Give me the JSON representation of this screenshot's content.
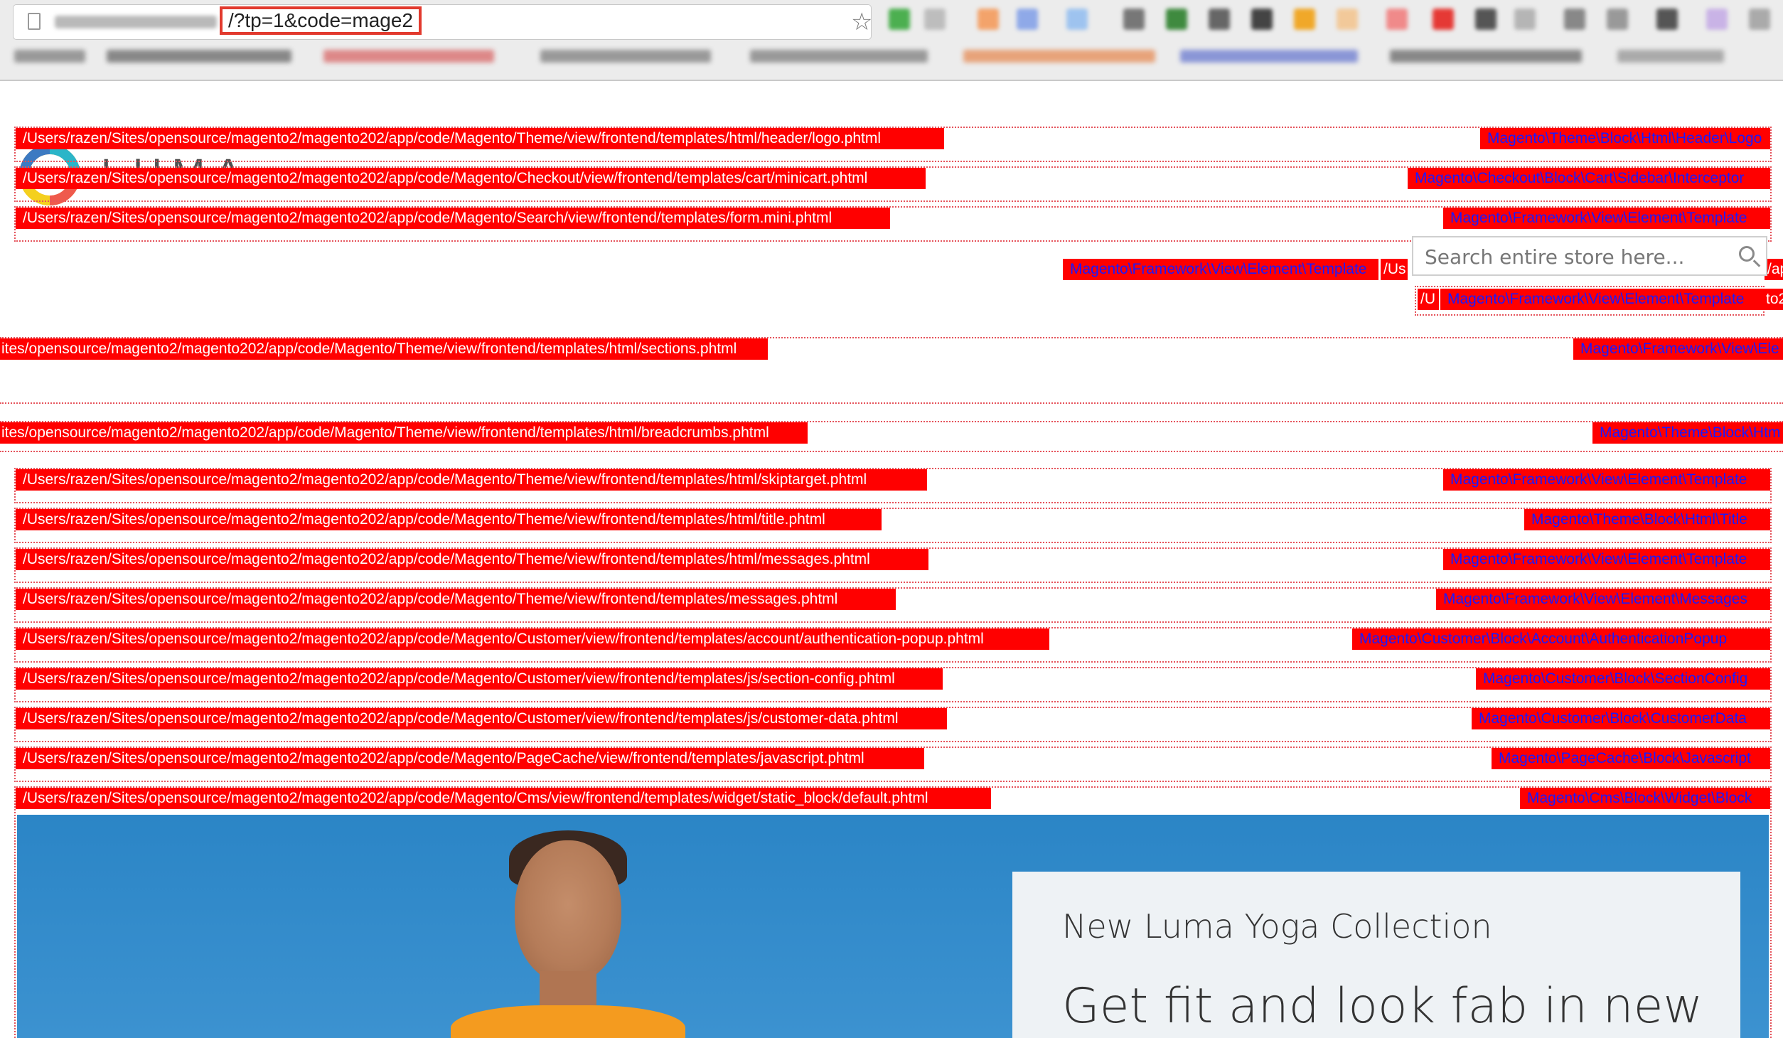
{
  "browser": {
    "url_visible": "/?tp=1&code=mage2",
    "bookmark_star": "star-icon"
  },
  "store": {
    "logo_text": "LUMA",
    "search_placeholder": "Search entire store here..."
  },
  "template_hints": [
    {
      "template": "/Users/razen/Sites/opensource/magento2/magento202/app/code/Magento/Theme/view/frontend/templates/html/header/logo.phtml",
      "block": "Magento\\Theme\\Block\\Html\\Header\\Logo"
    },
    {
      "template": "/Users/razen/Sites/opensource/magento2/magento202/app/code/Magento/Checkout/view/frontend/templates/cart/minicart.phtml",
      "block": "Magento\\Checkout\\Block\\Cart\\Sidebar\\Interceptor"
    },
    {
      "template": "/Users/razen/Sites/opensource/magento2/magento202/app/code/Magento/Search/view/frontend/templates/form.mini.phtml",
      "block": "Magento\\Framework\\View\\Element\\Template"
    },
    {
      "template": "/Us",
      "block": "Magento\\Framework\\View\\Element\\Template",
      "tail": "/ap"
    },
    {
      "template": "/U",
      "block": "Magento\\Framework\\View\\Element\\Template",
      "tail": "to2"
    },
    {
      "template": "ites/opensource/magento2/magento202/app/code/Magento/Theme/view/frontend/templates/html/sections.phtml",
      "block": "Magento\\Framework\\View\\Ele"
    },
    {
      "template": "ites/opensource/magento2/magento202/app/code/Magento/Theme/view/frontend/templates/html/breadcrumbs.phtml",
      "block": "Magento\\Theme\\Block\\Htm"
    },
    {
      "template": "/Users/razen/Sites/opensource/magento2/magento202/app/code/Magento/Theme/view/frontend/templates/html/skiptarget.phtml",
      "block": "Magento\\Framework\\View\\Element\\Template"
    },
    {
      "template": "/Users/razen/Sites/opensource/magento2/magento202/app/code/Magento/Theme/view/frontend/templates/html/title.phtml",
      "block": "Magento\\Theme\\Block\\Html\\Title"
    },
    {
      "template": "/Users/razen/Sites/opensource/magento2/magento202/app/code/Magento/Theme/view/frontend/templates/html/messages.phtml",
      "block": "Magento\\Framework\\View\\Element\\Template"
    },
    {
      "template": "/Users/razen/Sites/opensource/magento2/magento202/app/code/Magento/Theme/view/frontend/templates/messages.phtml",
      "block": "Magento\\Framework\\View\\Element\\Messages"
    },
    {
      "template": "/Users/razen/Sites/opensource/magento2/magento202/app/code/Magento/Customer/view/frontend/templates/account/authentication-popup.phtml",
      "block": "Magento\\Customer\\Block\\Account\\AuthenticationPopup"
    },
    {
      "template": "/Users/razen/Sites/opensource/magento2/magento202/app/code/Magento/Customer/view/frontend/templates/js/section-config.phtml",
      "block": "Magento\\Customer\\Block\\SectionConfig"
    },
    {
      "template": "/Users/razen/Sites/opensource/magento2/magento202/app/code/Magento/Customer/view/frontend/templates/js/customer-data.phtml",
      "block": "Magento\\Customer\\Block\\CustomerData"
    },
    {
      "template": "/Users/razen/Sites/opensource/magento2/magento202/app/code/Magento/PageCache/view/frontend/templates/javascript.phtml",
      "block": "Magento\\PageCache\\Block\\Javascript"
    },
    {
      "template": "/Users/razen/Sites/opensource/magento2/magento202/app/code/Magento/Cms/view/frontend/templates/widget/static_block/default.phtml",
      "block": "Magento\\Cms\\Block\\Widget\\Block"
    }
  ],
  "hero": {
    "subtitle": "New Luma Yoga Collection",
    "title": "Get fit and look fab in new"
  },
  "colors": {
    "hint_bg": "#ff0000",
    "hint_text": "#ffffff",
    "block_text": "#1a1aff",
    "hero_bg": "#2b85c6"
  }
}
